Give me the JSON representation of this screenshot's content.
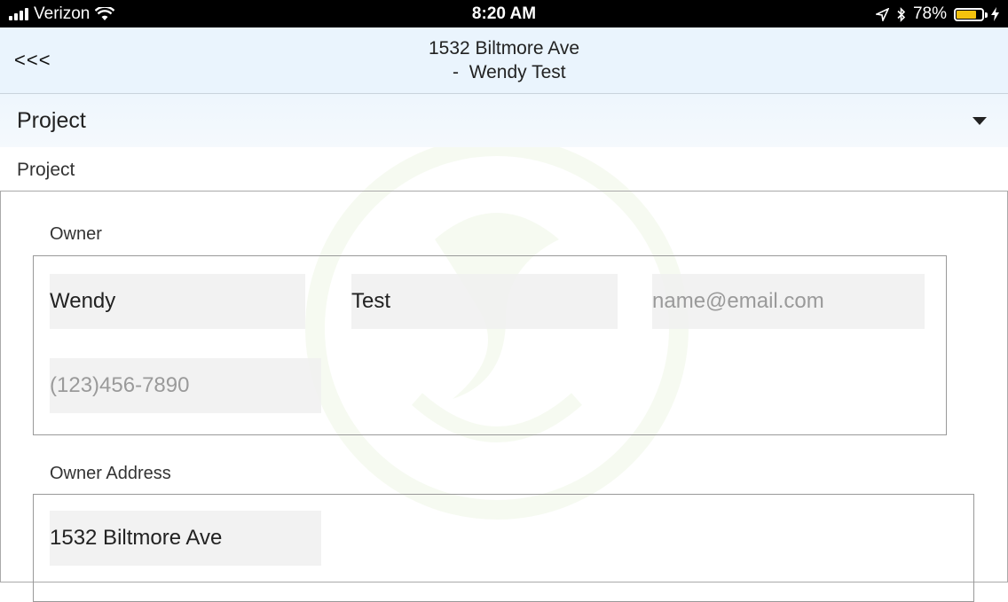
{
  "status_bar": {
    "carrier": "Verizon",
    "time": "8:20 AM",
    "battery_percent": "78%",
    "battery_level": 0.78
  },
  "header": {
    "back_label": "<<<",
    "title_line1": "1532 Biltmore Ave",
    "title_line2": "  -  Wendy Test"
  },
  "section": {
    "title": "Project",
    "label": "Project"
  },
  "owner": {
    "label": "Owner",
    "first_name": "Wendy",
    "last_name": "Test",
    "email_placeholder": "name@email.com",
    "phone_placeholder": "(123)456-7890"
  },
  "owner_address": {
    "label": "Owner Address",
    "street": "1532 Biltmore Ave"
  },
  "colors": {
    "header_bg": "#eaf4fd",
    "battery": "#f4c20d",
    "watermark": "#8bc34a"
  }
}
